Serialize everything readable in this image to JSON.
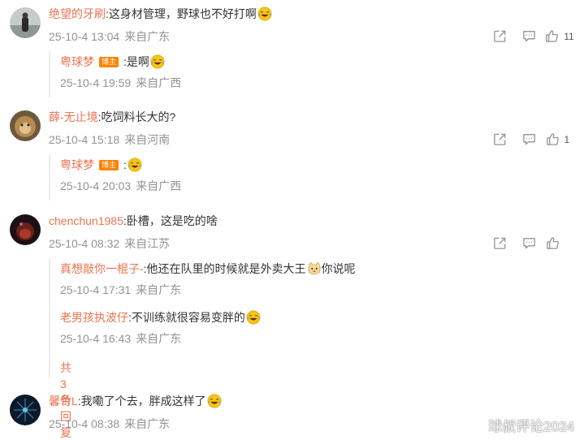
{
  "comments": [
    {
      "author": "绝望的牙刷",
      "text": ":这身材管理，野球也不好打啊",
      "date": "25-10-4 13:04",
      "location": "来自广东",
      "likes": "11",
      "replies": [
        {
          "author": "粤球梦",
          "badge": "博主",
          "text": ":是啊",
          "date": "25-10-4 19:59",
          "location": "来自广西"
        }
      ]
    },
    {
      "author": "薛-无止境",
      "text": ":吃饲料长大的?",
      "date": "25-10-4 15:18",
      "location": "来自河南",
      "likes": "1",
      "replies": [
        {
          "author": "粤球梦",
          "badge": "博主",
          "text": ":",
          "date": "25-10-4 20:03",
          "location": "来自广西"
        }
      ]
    },
    {
      "author": "chenchun1985",
      "text": ":卧槽，这是吃的啥",
      "date": "25-10-4 08:32",
      "location": "来自江苏",
      "likes": "",
      "replies": [
        {
          "author": "真想敲你一棍子-",
          "text": ":他还在队里的时候就是外卖大王",
          "text2": "你说呢",
          "date": "25-10-4 17:31",
          "location": "来自广东"
        },
        {
          "author": "老男孩执波仔",
          "text": ":不训练就很容易变胖的",
          "date": "25-10-4 16:43",
          "location": "来自广东"
        }
      ],
      "more_replies": "共3条回复"
    },
    {
      "author": "馨竹L",
      "text": ":我嘞了个去，胖成这样了",
      "date": "25-10-4 08:38",
      "location": "来自广东"
    }
  ],
  "watermark": "球叔评论2024"
}
